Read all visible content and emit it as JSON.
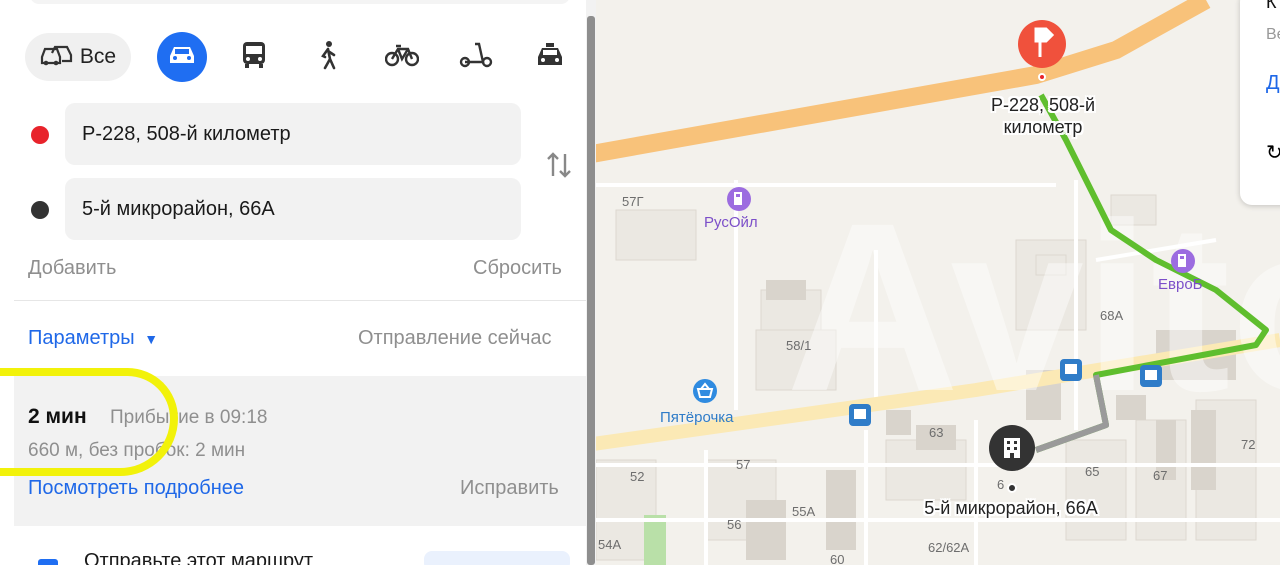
{
  "modes": {
    "all_label": "Все",
    "items": [
      "car-icon",
      "bus-icon",
      "pedestrian-icon",
      "bicycle-icon",
      "scooter-icon",
      "taxi-icon"
    ]
  },
  "route_points": {
    "from": "Р-228, 508-й километр",
    "to": "5-й микрорайон, 66А",
    "from_color": "#e8232b",
    "to_color": "#333333"
  },
  "actions": {
    "add": "Добавить",
    "reset": "Сбросить"
  },
  "params": {
    "label": "Параметры",
    "departure": "Отправление сейчас"
  },
  "route": {
    "duration": "2 мин",
    "arrival": "Прибытие в 09:18",
    "details": "660 м, без пробок: 2 мин",
    "more": "Посмотреть подробнее",
    "fix": "Исправить"
  },
  "share": {
    "text": "Отправьте этот маршрут"
  },
  "map": {
    "start_label": "Р-228, 508-й\nкилометр",
    "end_label": "5-й микрорайон, 66А",
    "poi_rusoil": "РусОйл",
    "poi_pyaterochka": "Пятёрочка",
    "poi_evro": "ЕвроБ",
    "buildings": [
      "57Г",
      "58/1",
      "68А",
      "63",
      "57",
      "52",
      "65",
      "67",
      "72",
      "56",
      "55А",
      "54А",
      "60",
      "62/62А",
      "6"
    ],
    "watermark": "Avito",
    "route_color": "#5fbe2e",
    "road_color": "#f8c27a"
  },
  "card": {
    "top": "К",
    "line1": "Ве",
    "line2": "Д"
  }
}
